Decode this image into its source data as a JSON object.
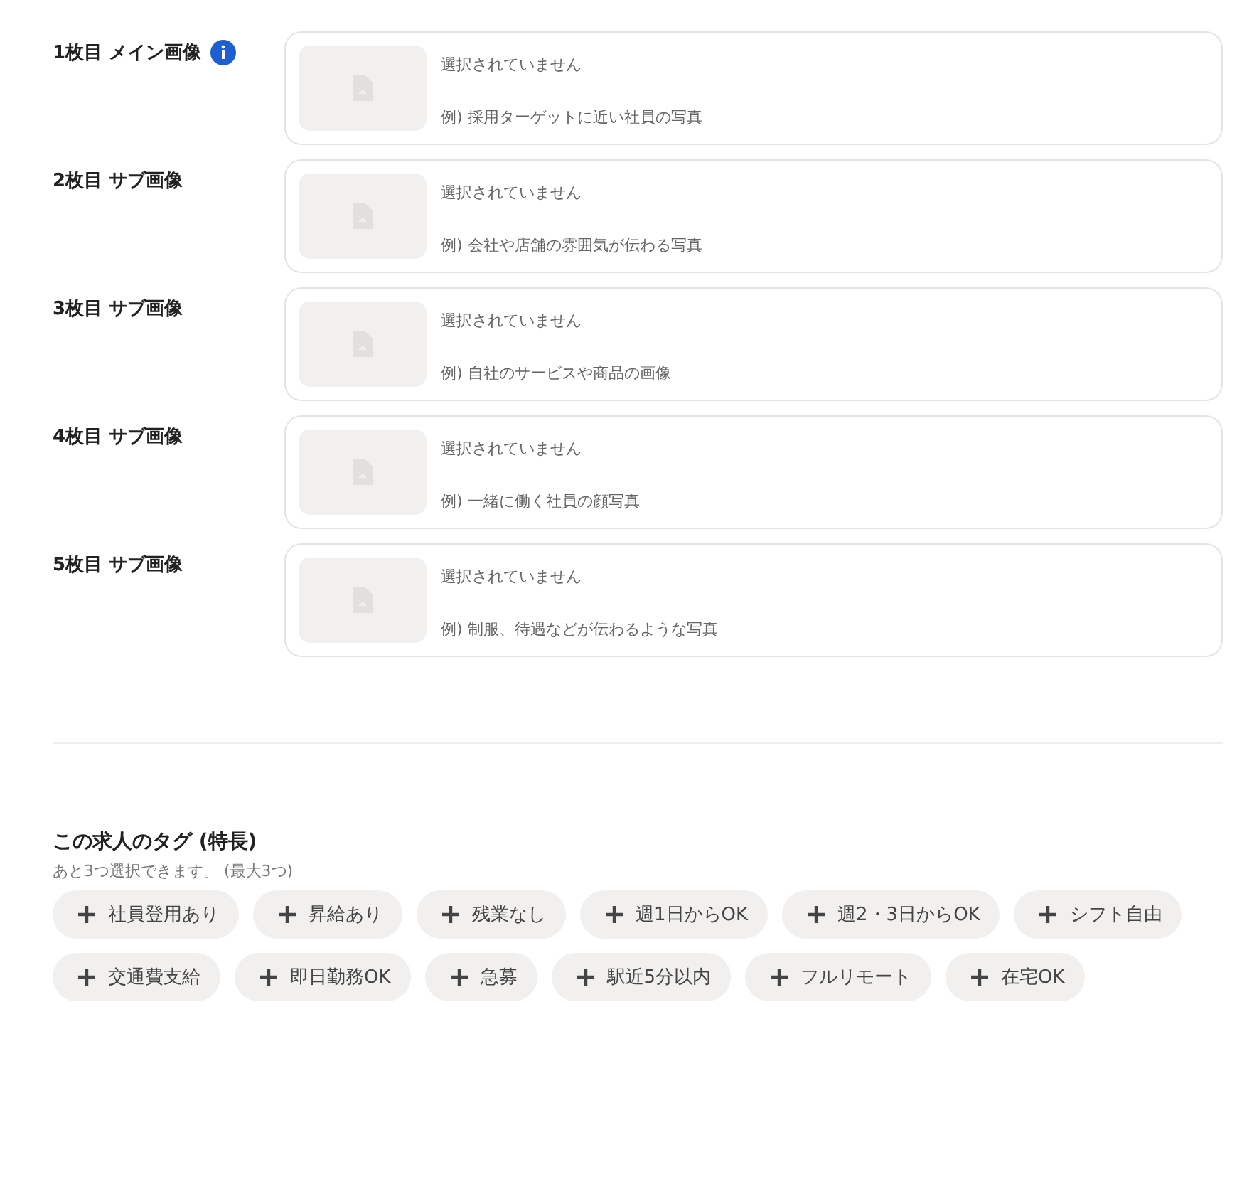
{
  "image_slots": [
    {
      "label": "1枚目 メイン画像",
      "info": true,
      "status": "選択されていません",
      "example": "例) 採用ターゲットに近い社員の写真"
    },
    {
      "label": "2枚目 サブ画像",
      "info": false,
      "status": "選択されていません",
      "example": "例) 会社や店舗の雰囲気が伝わる写真"
    },
    {
      "label": "3枚目 サブ画像",
      "info": false,
      "status": "選択されていません",
      "example": "例) 自社のサービスや商品の画像"
    },
    {
      "label": "4枚目 サブ画像",
      "info": false,
      "status": "選択されていません",
      "example": "例) 一緒に働く社員の顔写真"
    },
    {
      "label": "5枚目 サブ画像",
      "info": false,
      "status": "選択されていません",
      "example": "例) 制服、待遇などが伝わるような写真"
    }
  ],
  "tags": {
    "title": "この求人のタグ (特長)",
    "hint": "あと3つ選択できます。 (最大3つ)",
    "items": [
      {
        "label": "社員登用あり",
        "selected": false
      },
      {
        "label": "昇給あり",
        "selected": false
      },
      {
        "label": "残業なし",
        "selected": false
      },
      {
        "label": "週1日からOK",
        "selected": false
      },
      {
        "label": "週2・3日からOK",
        "selected": false
      },
      {
        "label": "シフト自由",
        "selected": false
      },
      {
        "label": "交通費支給",
        "selected": false
      },
      {
        "label": "即日勤務OK",
        "selected": false
      },
      {
        "label": "急募",
        "selected": false
      },
      {
        "label": "駅近5分以内",
        "selected": false
      },
      {
        "label": "フルリモート",
        "selected": false
      },
      {
        "label": "在宅OK",
        "selected": false
      }
    ]
  }
}
